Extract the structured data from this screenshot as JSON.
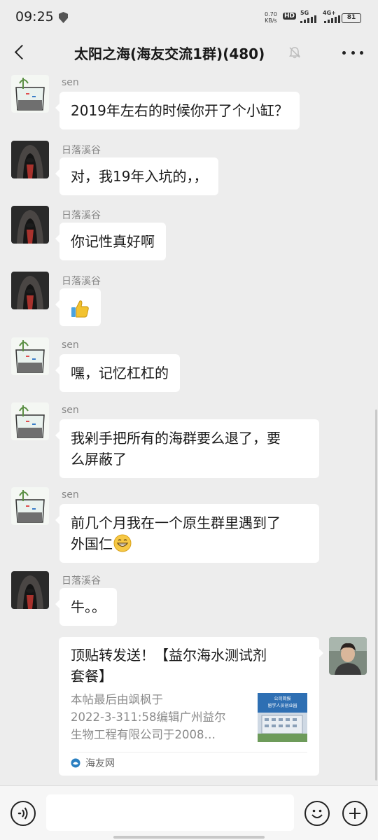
{
  "status_bar": {
    "time": "09:25",
    "net_speed_value": "0.70",
    "net_speed_unit": "KB/s",
    "hd_label": "HD",
    "sim1_label": "5G",
    "sim2_label": "4G+",
    "battery_level": "81"
  },
  "header": {
    "title": "太阳之海(海友交流1群)(480)"
  },
  "messages": [
    {
      "sender": "sen",
      "text": "2019年左右的时候你开了个小缸？",
      "avatar": "aquarium-avatar"
    },
    {
      "sender": "日落溪谷",
      "text": "对，我19年入坑的，，",
      "avatar": "hooded-figure-avatar"
    },
    {
      "sender": "日落溪谷",
      "text": "你记性真好啊",
      "avatar": "hooded-figure-avatar"
    },
    {
      "sender": "日落溪谷",
      "text": "",
      "emoji": "thumbs-up-emoji",
      "avatar": "hooded-figure-avatar"
    },
    {
      "sender": "sen",
      "text": "嘿，记忆杠杠的",
      "avatar": "aquarium-avatar"
    },
    {
      "sender": "sen",
      "text_line1": "我剁手把所有的海群要么退了，要",
      "text_line2": "么屏蔽了",
      "avatar": "aquarium-avatar"
    },
    {
      "sender": "sen",
      "text_line1": "前几个月我在一个原生群里遇到了",
      "text_line2": "外国仁",
      "emoji": "grin-emoji",
      "avatar": "aquarium-avatar"
    },
    {
      "sender": "日落溪谷",
      "text": "牛。。",
      "avatar": "hooded-figure-avatar"
    }
  ],
  "link_card": {
    "title_line1": "顶贴转发送！【益尔海水测试剂",
    "title_line2": "套餐】",
    "desc_line1": "本帖最后由飒枫于",
    "desc_line2": "2022-3-311:58编辑广州益尔",
    "desc_line3": "生物工程有限公司于2008…",
    "source": "海友网",
    "thumb_text1": "公司简报",
    "thumb_text2": "留学人员创业园"
  },
  "input_bar": {
    "placeholder": ""
  },
  "colors": {
    "background": "#ededed",
    "bubble": "#ffffff",
    "sender_name": "#888888"
  }
}
